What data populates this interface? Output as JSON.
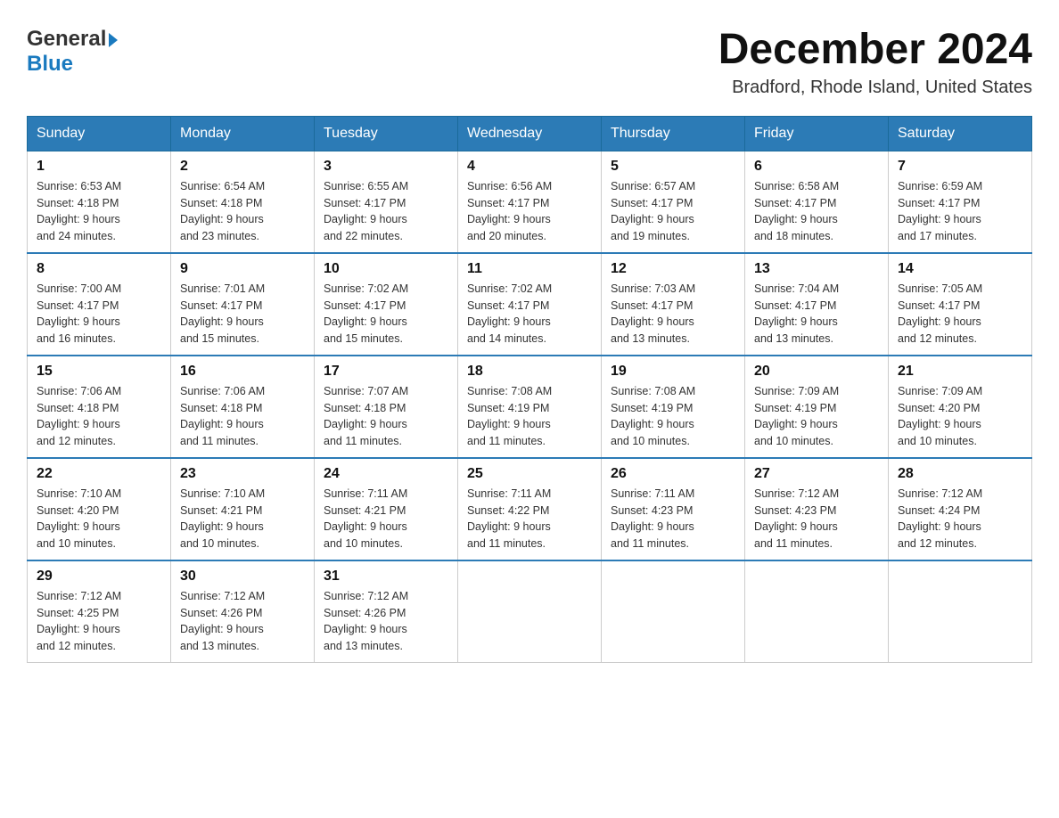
{
  "header": {
    "logo_general": "General",
    "logo_blue": "Blue",
    "month_title": "December 2024",
    "location": "Bradford, Rhode Island, United States"
  },
  "calendar": {
    "days_of_week": [
      "Sunday",
      "Monday",
      "Tuesday",
      "Wednesday",
      "Thursday",
      "Friday",
      "Saturday"
    ],
    "weeks": [
      [
        {
          "day": "1",
          "sunrise": "6:53 AM",
          "sunset": "4:18 PM",
          "daylight": "9 hours and 24 minutes."
        },
        {
          "day": "2",
          "sunrise": "6:54 AM",
          "sunset": "4:18 PM",
          "daylight": "9 hours and 23 minutes."
        },
        {
          "day": "3",
          "sunrise": "6:55 AM",
          "sunset": "4:17 PM",
          "daylight": "9 hours and 22 minutes."
        },
        {
          "day": "4",
          "sunrise": "6:56 AM",
          "sunset": "4:17 PM",
          "daylight": "9 hours and 20 minutes."
        },
        {
          "day": "5",
          "sunrise": "6:57 AM",
          "sunset": "4:17 PM",
          "daylight": "9 hours and 19 minutes."
        },
        {
          "day": "6",
          "sunrise": "6:58 AM",
          "sunset": "4:17 PM",
          "daylight": "9 hours and 18 minutes."
        },
        {
          "day": "7",
          "sunrise": "6:59 AM",
          "sunset": "4:17 PM",
          "daylight": "9 hours and 17 minutes."
        }
      ],
      [
        {
          "day": "8",
          "sunrise": "7:00 AM",
          "sunset": "4:17 PM",
          "daylight": "9 hours and 16 minutes."
        },
        {
          "day": "9",
          "sunrise": "7:01 AM",
          "sunset": "4:17 PM",
          "daylight": "9 hours and 15 minutes."
        },
        {
          "day": "10",
          "sunrise": "7:02 AM",
          "sunset": "4:17 PM",
          "daylight": "9 hours and 15 minutes."
        },
        {
          "day": "11",
          "sunrise": "7:02 AM",
          "sunset": "4:17 PM",
          "daylight": "9 hours and 14 minutes."
        },
        {
          "day": "12",
          "sunrise": "7:03 AM",
          "sunset": "4:17 PM",
          "daylight": "9 hours and 13 minutes."
        },
        {
          "day": "13",
          "sunrise": "7:04 AM",
          "sunset": "4:17 PM",
          "daylight": "9 hours and 13 minutes."
        },
        {
          "day": "14",
          "sunrise": "7:05 AM",
          "sunset": "4:17 PM",
          "daylight": "9 hours and 12 minutes."
        }
      ],
      [
        {
          "day": "15",
          "sunrise": "7:06 AM",
          "sunset": "4:18 PM",
          "daylight": "9 hours and 12 minutes."
        },
        {
          "day": "16",
          "sunrise": "7:06 AM",
          "sunset": "4:18 PM",
          "daylight": "9 hours and 11 minutes."
        },
        {
          "day": "17",
          "sunrise": "7:07 AM",
          "sunset": "4:18 PM",
          "daylight": "9 hours and 11 minutes."
        },
        {
          "day": "18",
          "sunrise": "7:08 AM",
          "sunset": "4:19 PM",
          "daylight": "9 hours and 11 minutes."
        },
        {
          "day": "19",
          "sunrise": "7:08 AM",
          "sunset": "4:19 PM",
          "daylight": "9 hours and 10 minutes."
        },
        {
          "day": "20",
          "sunrise": "7:09 AM",
          "sunset": "4:19 PM",
          "daylight": "9 hours and 10 minutes."
        },
        {
          "day": "21",
          "sunrise": "7:09 AM",
          "sunset": "4:20 PM",
          "daylight": "9 hours and 10 minutes."
        }
      ],
      [
        {
          "day": "22",
          "sunrise": "7:10 AM",
          "sunset": "4:20 PM",
          "daylight": "9 hours and 10 minutes."
        },
        {
          "day": "23",
          "sunrise": "7:10 AM",
          "sunset": "4:21 PM",
          "daylight": "9 hours and 10 minutes."
        },
        {
          "day": "24",
          "sunrise": "7:11 AM",
          "sunset": "4:21 PM",
          "daylight": "9 hours and 10 minutes."
        },
        {
          "day": "25",
          "sunrise": "7:11 AM",
          "sunset": "4:22 PM",
          "daylight": "9 hours and 11 minutes."
        },
        {
          "day": "26",
          "sunrise": "7:11 AM",
          "sunset": "4:23 PM",
          "daylight": "9 hours and 11 minutes."
        },
        {
          "day": "27",
          "sunrise": "7:12 AM",
          "sunset": "4:23 PM",
          "daylight": "9 hours and 11 minutes."
        },
        {
          "day": "28",
          "sunrise": "7:12 AM",
          "sunset": "4:24 PM",
          "daylight": "9 hours and 12 minutes."
        }
      ],
      [
        {
          "day": "29",
          "sunrise": "7:12 AM",
          "sunset": "4:25 PM",
          "daylight": "9 hours and 12 minutes."
        },
        {
          "day": "30",
          "sunrise": "7:12 AM",
          "sunset": "4:26 PM",
          "daylight": "9 hours and 13 minutes."
        },
        {
          "day": "31",
          "sunrise": "7:12 AM",
          "sunset": "4:26 PM",
          "daylight": "9 hours and 13 minutes."
        },
        null,
        null,
        null,
        null
      ]
    ],
    "labels": {
      "sunrise": "Sunrise:",
      "sunset": "Sunset:",
      "daylight": "Daylight: 9 hours"
    }
  }
}
